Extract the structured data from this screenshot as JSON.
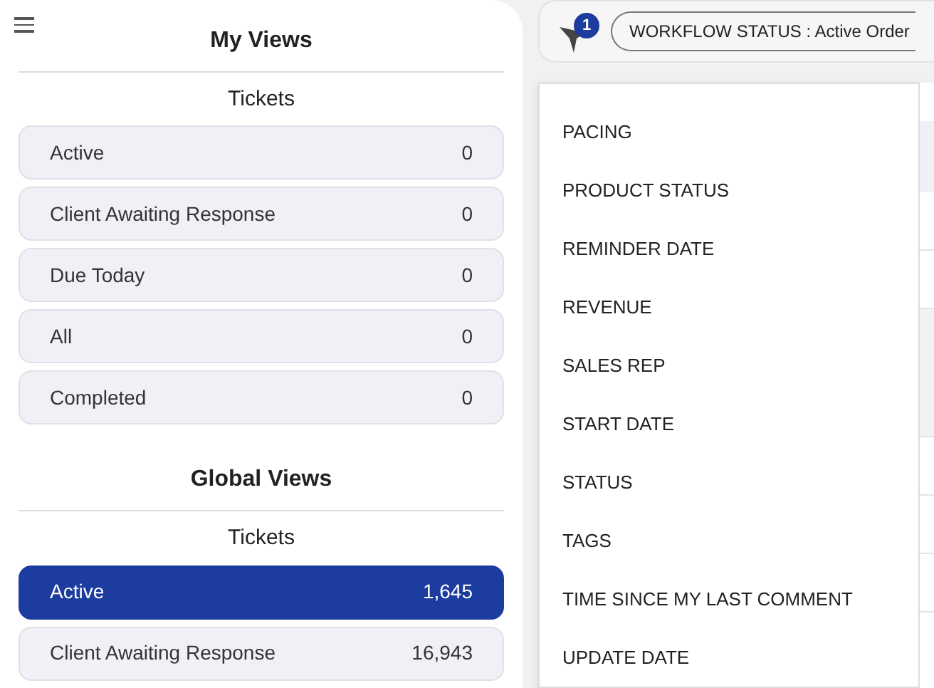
{
  "sidebar": {
    "sections": [
      {
        "title": "My Views",
        "subtitle": "Tickets",
        "items": [
          {
            "label": "Active",
            "count": "0",
            "selected": false
          },
          {
            "label": "Client Awaiting Response",
            "count": "0",
            "selected": false
          },
          {
            "label": "Due Today",
            "count": "0",
            "selected": false
          },
          {
            "label": "All",
            "count": "0",
            "selected": false
          },
          {
            "label": "Completed",
            "count": "0",
            "selected": false
          }
        ]
      },
      {
        "title": "Global Views",
        "subtitle": "Tickets",
        "items": [
          {
            "label": "Active",
            "count": "1,645",
            "selected": true
          },
          {
            "label": "Client Awaiting Response",
            "count": "16,943",
            "selected": false
          }
        ]
      }
    ]
  },
  "filter_bar": {
    "badge": "1",
    "chips": [
      "WORKFLOW STATUS : Active Order"
    ]
  },
  "dropdown": {
    "items": [
      "PACING",
      "PRODUCT STATUS",
      "REMINDER DATE",
      "REVENUE",
      "SALES REP",
      "START DATE",
      "STATUS",
      "TAGS",
      "TIME SINCE MY LAST COMMENT",
      "UPDATE DATE"
    ]
  }
}
